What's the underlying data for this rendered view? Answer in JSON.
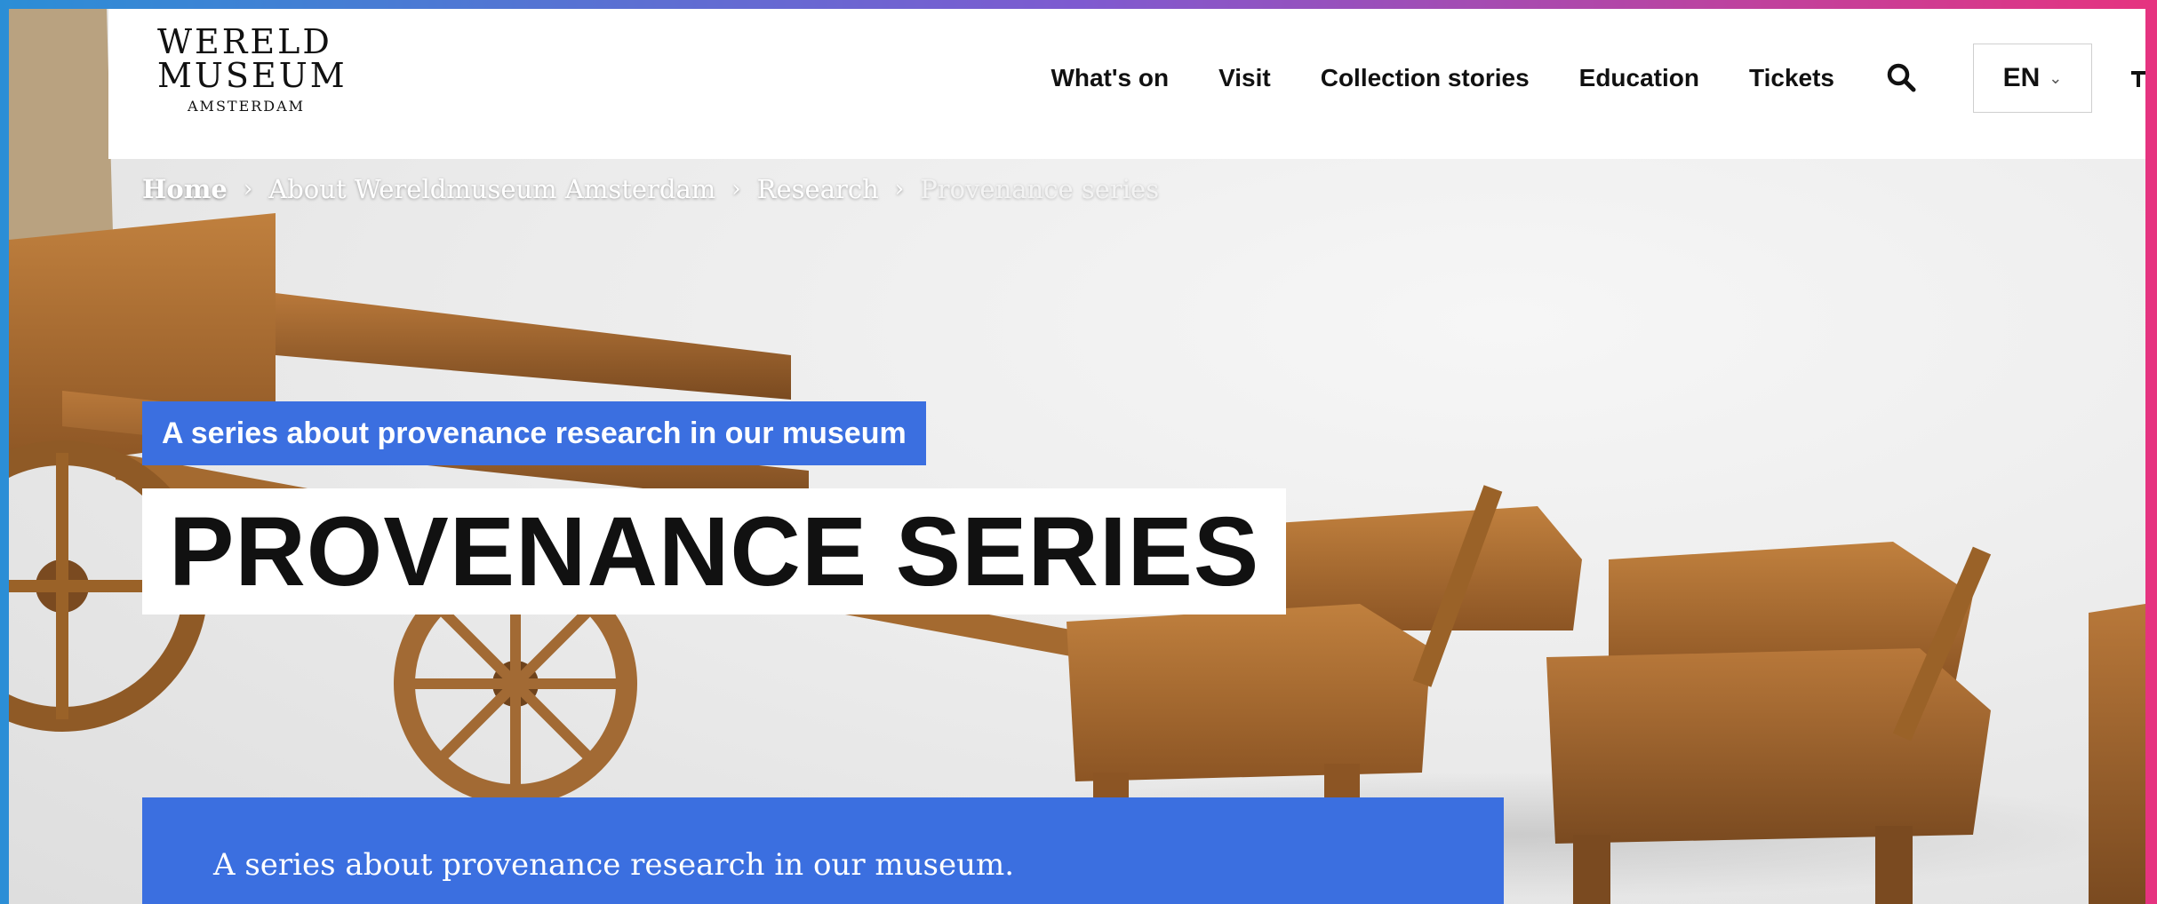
{
  "logo": {
    "line1": "WERELD",
    "line2": "MUSEUM",
    "line3": "AMSTERDAM"
  },
  "nav": {
    "items": [
      "What's on",
      "Visit",
      "Collection stories",
      "Education",
      "Tickets"
    ],
    "search_icon": "search-icon",
    "language": "EN"
  },
  "breadcrumb": {
    "home": "Home",
    "items": [
      "About Wereldmuseum Amsterdam",
      "Research"
    ],
    "current": "Provenance series"
  },
  "hero": {
    "tagline": "A series about provenance research in our museum",
    "title": "PROVENANCE SERIES",
    "intro": "A series about provenance research in our museum."
  },
  "colors": {
    "accent": "#3b6fe0",
    "frame_left": "#2b8ed6",
    "frame_right": "#e6337f"
  }
}
